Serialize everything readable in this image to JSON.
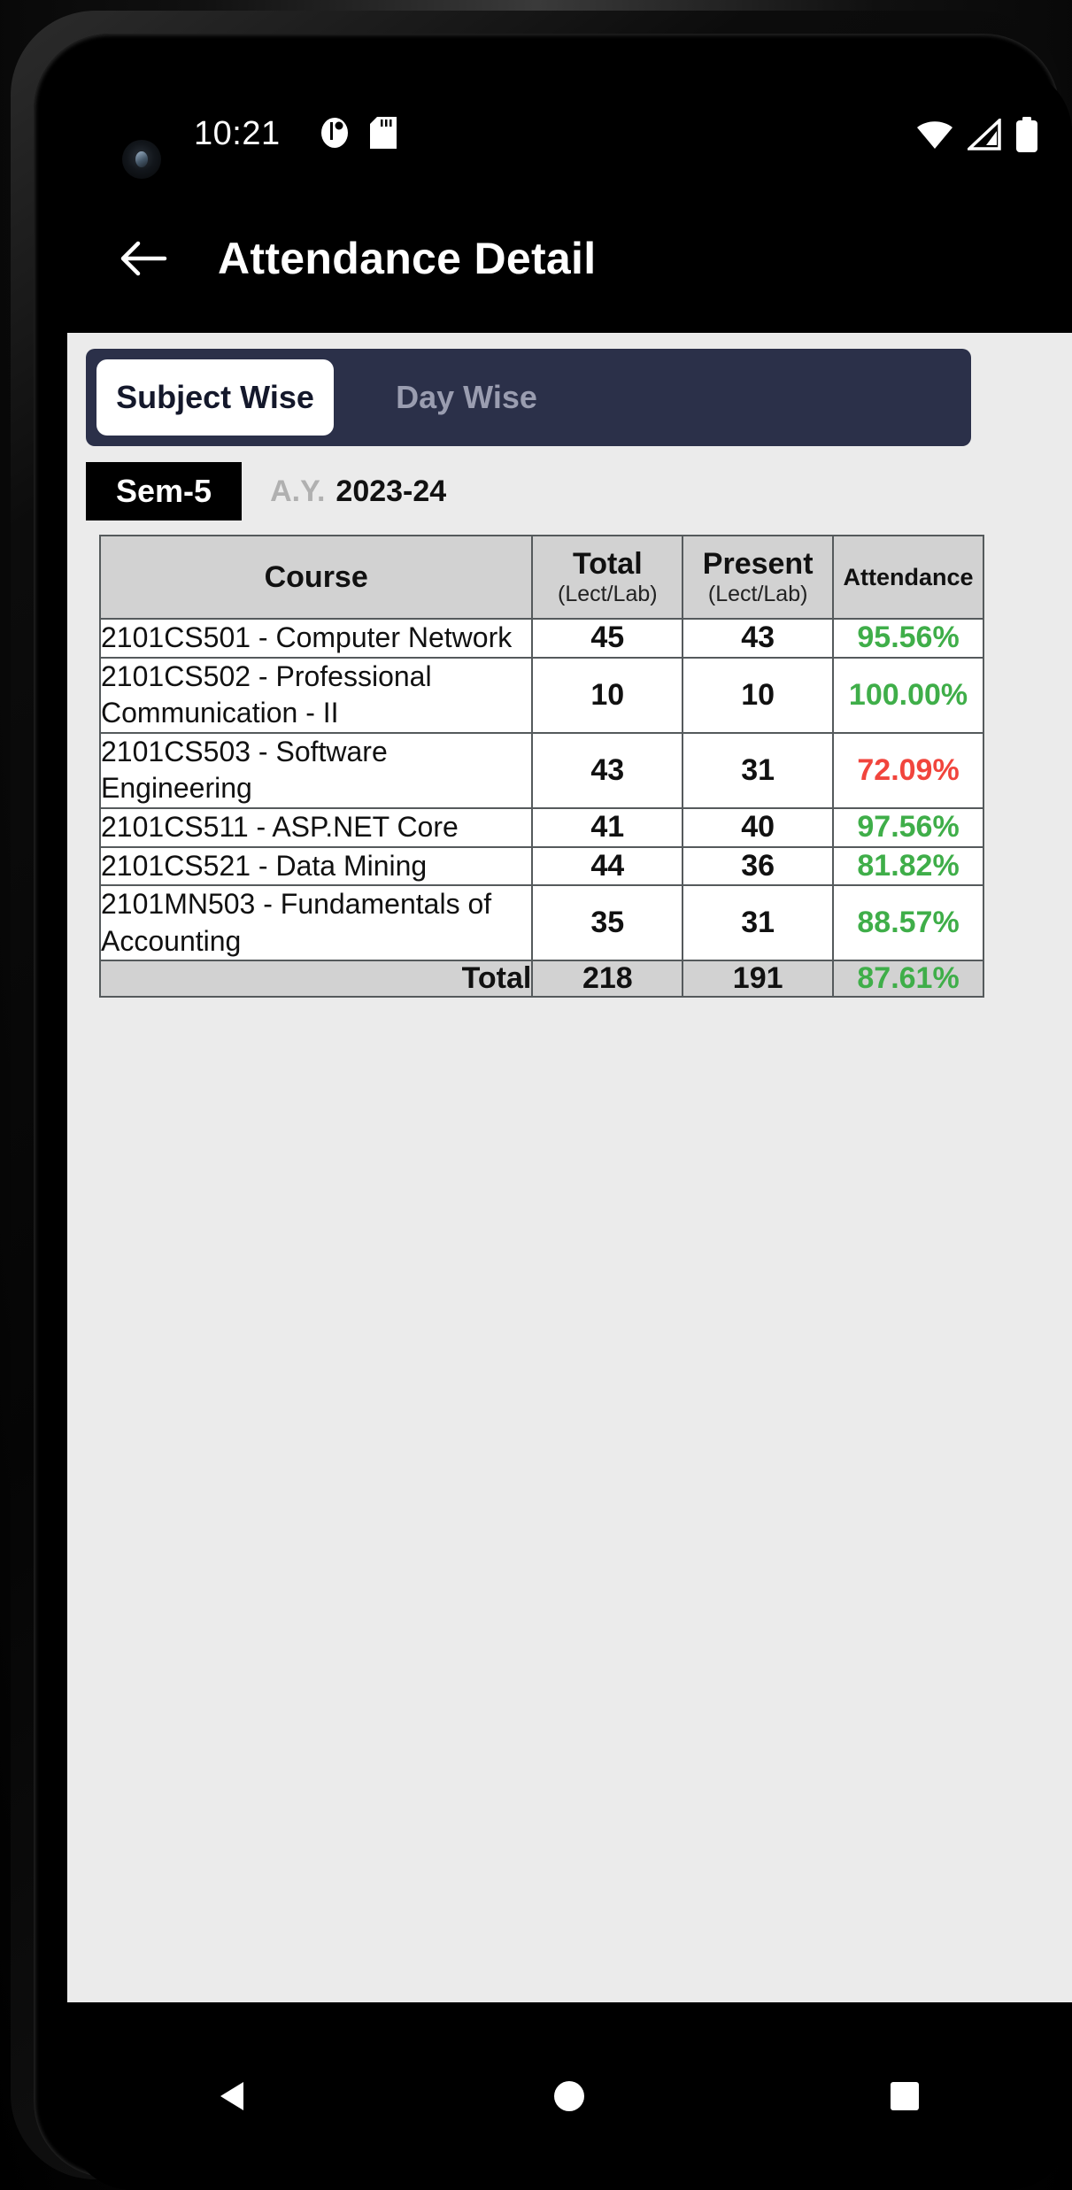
{
  "status_bar": {
    "time": "10:21",
    "left_icons": [
      "notification-icon",
      "sd-card-icon"
    ],
    "right_icons": [
      "wifi-icon",
      "cellular-signal-icon",
      "battery-icon"
    ]
  },
  "app_bar": {
    "back_icon": "back-arrow-icon",
    "title": "Attendance Detail"
  },
  "tabs": [
    {
      "label": "Subject Wise",
      "active": true
    },
    {
      "label": "Day Wise",
      "active": false
    }
  ],
  "filters": {
    "semester": "Sem-5",
    "ay_label": "A.Y.",
    "ay_value": "2023-24"
  },
  "table": {
    "headers": [
      {
        "main": "Course",
        "sub": ""
      },
      {
        "main": "Total",
        "sub": "(Lect/Lab)"
      },
      {
        "main": "Present",
        "sub": "(Lect/Lab)"
      },
      {
        "main": "Attendance",
        "sub": ""
      }
    ],
    "rows": [
      {
        "course": "2101CS501 - Computer Network",
        "total": "45",
        "present": "43",
        "attendance": "95.56%",
        "status": "good"
      },
      {
        "course": "2101CS502 - Professional Communication - II",
        "total": "10",
        "present": "10",
        "attendance": "100.00%",
        "status": "good"
      },
      {
        "course": "2101CS503 - Software Engineering",
        "total": "43",
        "present": "31",
        "attendance": "72.09%",
        "status": "low"
      },
      {
        "course": "2101CS511 - ASP.NET Core",
        "total": "41",
        "present": "40",
        "attendance": "97.56%",
        "status": "good"
      },
      {
        "course": "2101CS521 - Data Mining",
        "total": "44",
        "present": "36",
        "attendance": "81.82%",
        "status": "good"
      },
      {
        "course": "2101MN503 - Fundamentals of Accounting",
        "total": "35",
        "present": "31",
        "attendance": "88.57%",
        "status": "good"
      }
    ],
    "total_row": {
      "label": "Total",
      "total": "218",
      "present": "191",
      "attendance": "87.61%",
      "status": "good"
    }
  },
  "nav_bar": {
    "buttons": [
      "back-triangle-icon",
      "home-circle-icon",
      "recents-square-icon"
    ]
  },
  "colors": {
    "accent_navy": "#2b3049",
    "good": "#3fae49",
    "low": "#f1453d",
    "page_bg": "#ebebeb",
    "header_bg": "#d2d2d2"
  }
}
